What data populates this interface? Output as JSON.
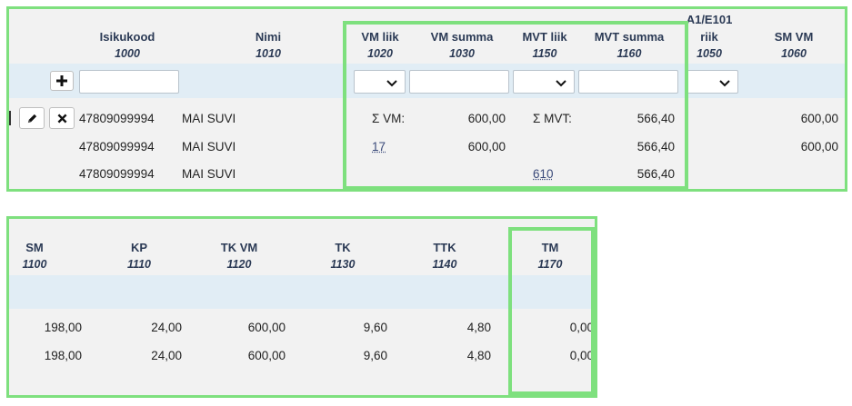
{
  "top_table": {
    "columns": [
      {
        "title": "Isikukood",
        "code": "1000"
      },
      {
        "title": "Nimi",
        "code": "1010"
      },
      {
        "title": "VM liik",
        "code": "1020"
      },
      {
        "title": "VM summa",
        "code": "1030"
      },
      {
        "title": "MVT liik",
        "code": "1150"
      },
      {
        "title": "MVT summa",
        "code": "1160"
      },
      {
        "title": "A1/E101 riik",
        "code": "1050"
      },
      {
        "title": "SM VM",
        "code": "1060"
      }
    ],
    "rows": [
      {
        "isikukood": "47809099994",
        "nimi": "MAI SUVI",
        "vm_liik": "Σ VM:",
        "vm_summa": "600,00",
        "mvt_liik": "Σ MVT:",
        "mvt_summa": "566,40",
        "sm_vm": "600,00"
      },
      {
        "isikukood": "47809099994",
        "nimi": "MAI SUVI",
        "vm_liik": "17",
        "vm_summa": "600,00",
        "mvt_liik": "",
        "mvt_summa": "566,40",
        "sm_vm": "600,00"
      },
      {
        "isikukood": "47809099994",
        "nimi": "MAI SUVI",
        "vm_liik": "",
        "vm_summa": "",
        "mvt_liik": "610",
        "mvt_summa": "566,40",
        "sm_vm": ""
      }
    ]
  },
  "bottom_table": {
    "columns": [
      {
        "title": "SM",
        "code": "1100"
      },
      {
        "title": "KP",
        "code": "1110"
      },
      {
        "title": "TK VM",
        "code": "1120"
      },
      {
        "title": "TK",
        "code": "1130"
      },
      {
        "title": "TTK",
        "code": "1140"
      },
      {
        "title": "TM",
        "code": "1170"
      }
    ],
    "rows": [
      {
        "sm": "198,00",
        "kp": "24,00",
        "tk_vm": "600,00",
        "tk": "9,60",
        "ttk": "4,80",
        "tm": "0,00"
      },
      {
        "sm": "198,00",
        "kp": "24,00",
        "tk_vm": "600,00",
        "tk": "9,60",
        "ttk": "4,80",
        "tm": "0,00"
      }
    ]
  },
  "icons": {
    "add": "plus-icon",
    "edit": "pencil-icon",
    "delete": "x-icon",
    "dropdown": "chevron-down-icon"
  },
  "colors": {
    "highlight": "#7ee07e",
    "filter_band": "#e1edf5",
    "panel": "#f2f2f2",
    "header_text": "#2b3a55"
  }
}
